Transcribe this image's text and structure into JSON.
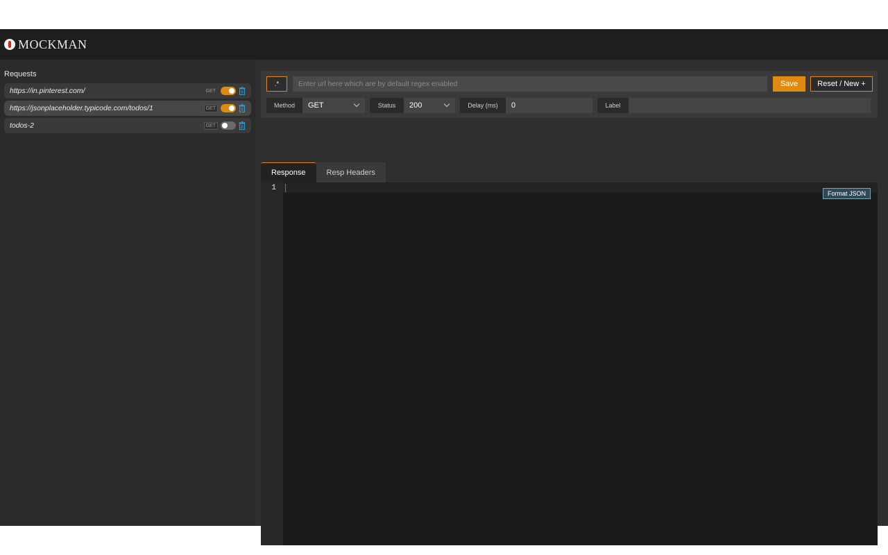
{
  "app": {
    "brand": "MOCKMAN"
  },
  "sidebar": {
    "title": "Requests",
    "items": [
      {
        "url": "https://in.pinterest.com/",
        "method": "GET",
        "enabled": true
      },
      {
        "url": "https://jsonplaceholder.typicode.com/todos/1",
        "method": "GET",
        "enabled": true
      },
      {
        "url": "todos-2",
        "method": "GET",
        "enabled": false
      }
    ]
  },
  "form": {
    "regex_label": ".*",
    "url_placeholder": "Enter url here which are by default regex enabled",
    "save_label": "Save",
    "reset_label": "Reset / New +",
    "method_label": "Method",
    "method_value": "GET",
    "status_label": "Status",
    "status_value": "200",
    "delay_label": "Delay (ms)",
    "delay_value": "0",
    "label_label": "Label",
    "label_value": ""
  },
  "tabs": [
    {
      "label": "Response"
    },
    {
      "label": "Resp Headers"
    }
  ],
  "editor": {
    "line_number": "1",
    "format_label": "Format JSON"
  },
  "colors": {
    "accent": "#e08a10",
    "trash": "#2f9fd0"
  }
}
